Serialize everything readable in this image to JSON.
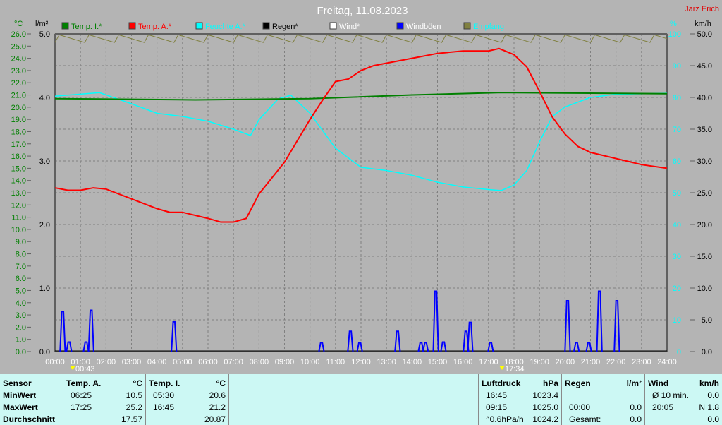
{
  "title": "Freitag, 11.08.2023",
  "author": "Jarz Erich",
  "axis_units": {
    "temp": "°C",
    "rain": "l/m²",
    "hum": "%",
    "wind": "km/h"
  },
  "colors": {
    "temp_i": "#008000",
    "temp_a": "#ff0000",
    "hum": "#00ffff",
    "rain": "#000000",
    "wind": "#ffffff",
    "gust": "#0000ff",
    "signal": "#808040"
  },
  "markers": [
    "00:43",
    "17:34"
  ],
  "chart_data": {
    "type": "line",
    "title": "Freitag, 11.08.2023",
    "legend": [
      "Temp. I.*",
      "Temp. A.*",
      "Feuchte A.*",
      "Regen*",
      "Wind*",
      "Windböen",
      "Empfang"
    ],
    "legend_placement": "top",
    "x_ticks": [
      "00:00",
      "01:00",
      "02:00",
      "03:00",
      "04:00",
      "05:00",
      "06:00",
      "07:00",
      "08:00",
      "09:00",
      "10:00",
      "11:00",
      "12:00",
      "13:00",
      "14:00",
      "15:00",
      "16:00",
      "17:00",
      "18:00",
      "19:00",
      "20:00",
      "21:00",
      "22:00",
      "23:00",
      "24:00"
    ],
    "ylim_temp": [
      0,
      26
    ],
    "ylim_rain": [
      0,
      5
    ],
    "ylim_hum": [
      0,
      100
    ],
    "ylim_wind": [
      0,
      50
    ],
    "temp_a": {
      "min": [
        0,
        30,
        60,
        90,
        120,
        180,
        240,
        270,
        300,
        360,
        390,
        420,
        450,
        480,
        540,
        600,
        630,
        660,
        690,
        720,
        750,
        780,
        840,
        900,
        960,
        1020,
        1045,
        1080,
        1110,
        1140,
        1170,
        1200,
        1230,
        1260,
        1320,
        1380,
        1440
      ],
      "v": [
        13.4,
        13.2,
        13.2,
        13.4,
        13.3,
        12.5,
        11.7,
        11.4,
        11.4,
        10.9,
        10.6,
        10.6,
        10.9,
        12.9,
        15.5,
        19.0,
        20.6,
        22.1,
        22.3,
        23.0,
        23.4,
        23.6,
        24.0,
        24.4,
        24.6,
        24.6,
        24.8,
        24.3,
        23.3,
        21.3,
        19.2,
        17.8,
        16.8,
        16.3,
        15.8,
        15.3,
        15.0
      ]
    },
    "temp_i": {
      "min": [
        0,
        330,
        600,
        840,
        1050,
        1440
      ],
      "v": [
        20.7,
        20.6,
        20.7,
        21.0,
        21.2,
        21.1
      ]
    },
    "hum": {
      "min": [
        0,
        105,
        180,
        240,
        300,
        360,
        420,
        460,
        480,
        525,
        555,
        600,
        660,
        720,
        780,
        840,
        900,
        960,
        1020,
        1050,
        1080,
        1110,
        1140,
        1170,
        1200,
        1260,
        1320,
        1440
      ],
      "v": [
        80.4,
        81.5,
        78,
        75,
        74,
        72.5,
        70,
        68,
        73,
        79.5,
        80.7,
        75,
        64,
        58,
        57,
        55.5,
        53.3,
        51.8,
        51,
        50.7,
        52.4,
        57,
        66,
        74,
        77,
        80,
        81,
        81.3
      ]
    },
    "gust": {
      "min": [
        18,
        33,
        73,
        85,
        280,
        627,
        695,
        717,
        806,
        861,
        872,
        896,
        914,
        967,
        977,
        1025,
        1206,
        1227,
        1256,
        1281,
        1322
      ],
      "v": [
        6.3,
        1.5,
        1.5,
        6.5,
        4.7,
        1.4,
        3.2,
        1.4,
        3.2,
        1.4,
        1.4,
        9.5,
        1.5,
        3.2,
        4.6,
        1.4,
        8.0,
        1.4,
        1.4,
        9.5,
        8.0
      ]
    },
    "rain_total": 0.0,
    "signal_level": 98.5
  },
  "table": {
    "sensor": [
      "Sensor",
      "MinWert",
      "MaxWert",
      "Durchschnitt"
    ],
    "ta": {
      "head": "Temp. A.",
      "unit": "°C",
      "rows": [
        [
          "06:25",
          "10.5"
        ],
        [
          "17:25",
          "25.2"
        ],
        [
          "",
          "17.57"
        ]
      ]
    },
    "ti": {
      "head": "Temp. I.",
      "unit": "°C",
      "rows": [
        [
          "05:30",
          "20.6"
        ],
        [
          "16:45",
          "21.2"
        ],
        [
          "",
          "20.87"
        ]
      ]
    },
    "p": {
      "head": "Luftdruck",
      "unit": "hPa",
      "rows": [
        [
          "16:45",
          "1023.4"
        ],
        [
          "09:15",
          "1025.0"
        ],
        [
          "^0.6hPa/h",
          "1024.2"
        ]
      ]
    },
    "r": {
      "head": "Regen",
      "unit": "l/m²",
      "rows": [
        [
          "",
          ""
        ],
        [
          "00:00",
          "0.0"
        ],
        [
          "Gesamt:",
          "0.0"
        ]
      ]
    },
    "w": {
      "head": "Wind",
      "unit": "km/h",
      "rows": [
        [
          "Ø 10 min.",
          "0.0"
        ],
        [
          "20:05",
          "N 1.8"
        ],
        [
          "",
          "0.0"
        ]
      ]
    }
  }
}
